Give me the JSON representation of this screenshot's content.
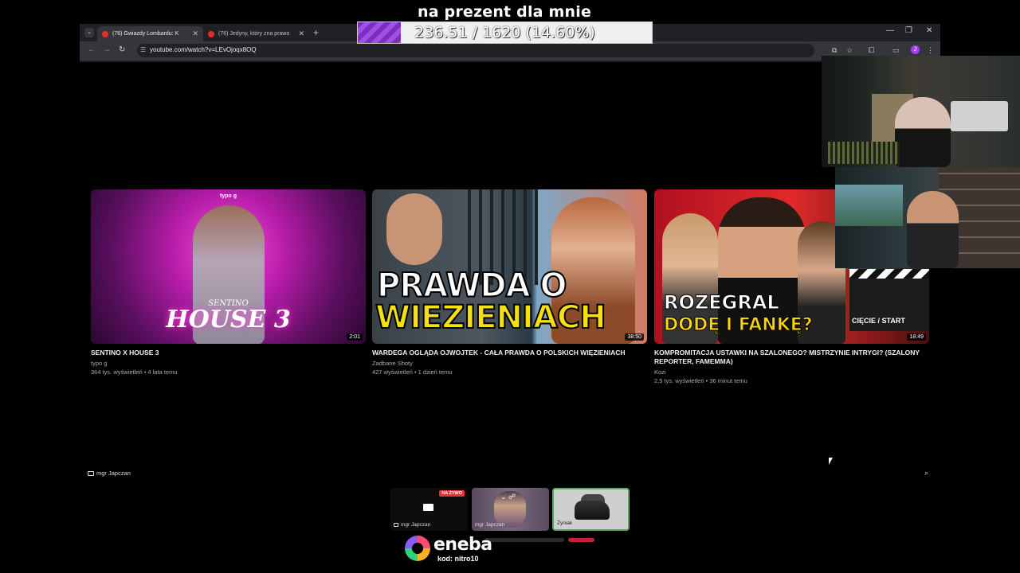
{
  "overlay": {
    "title": "na prezent dla mnie",
    "progress_text": "236.51 / 1620 (14.60%)",
    "progress_fraction": 0.146
  },
  "browser": {
    "tabs": [
      {
        "label": "(76) Gwiazdy Lombardu: K",
        "close": "✕"
      },
      {
        "label": "(76) Jedyny, który zna prawo",
        "close": "✕"
      }
    ],
    "new_tab": "+",
    "url": "youtube.com/watch?v=LEvOjoqx8OQ",
    "profile_initial": "J"
  },
  "videos": [
    {
      "title": "SENTINO X HOUSE 3",
      "channel": "typo g",
      "meta": "364 tys. wyświetleń • 4 lata temu",
      "duration": "2:01",
      "thumb_brand": "typo g",
      "thumb_tag": "SENTINO",
      "thumb_text": "HOUSE 3"
    },
    {
      "title": "WARDEGA OGLĄDA OJWOJTEK - CAŁA PRAWDA O POLSKICH WIĘZIENIACH",
      "channel": "Zadbane Shoty",
      "meta": "427 wyświetleń • 1 dzień temu",
      "duration": "38:50",
      "thumb_line1": "PRAWDA O",
      "thumb_line2": "WIEZIENIACH"
    },
    {
      "title": "KOMPROMITACJA USTAWKI NA SZALONEGO? MISTRZYNIE INTRYGI? (SZALONY REPORTER, FAMEMMA)",
      "channel": "Kozi",
      "meta": "2,5 tys. wyświetleń • 36 minut temu",
      "duration": "18:49",
      "thumb_line1": "ROZEGRAL",
      "thumb_line2": "DODĘ I FANKĘ?",
      "thumb_clap": "CIĘCIE / START"
    }
  ],
  "stream": {
    "presenter": "mgr Japczan",
    "tiles": [
      {
        "label": "mgr Japczan",
        "badge": "NA ŻYWO"
      },
      {
        "label": "mgr Japczan"
      },
      {
        "label": "Żyniak"
      }
    ]
  },
  "sponsor": {
    "name": "eneba",
    "code": "kod: nitro10"
  }
}
